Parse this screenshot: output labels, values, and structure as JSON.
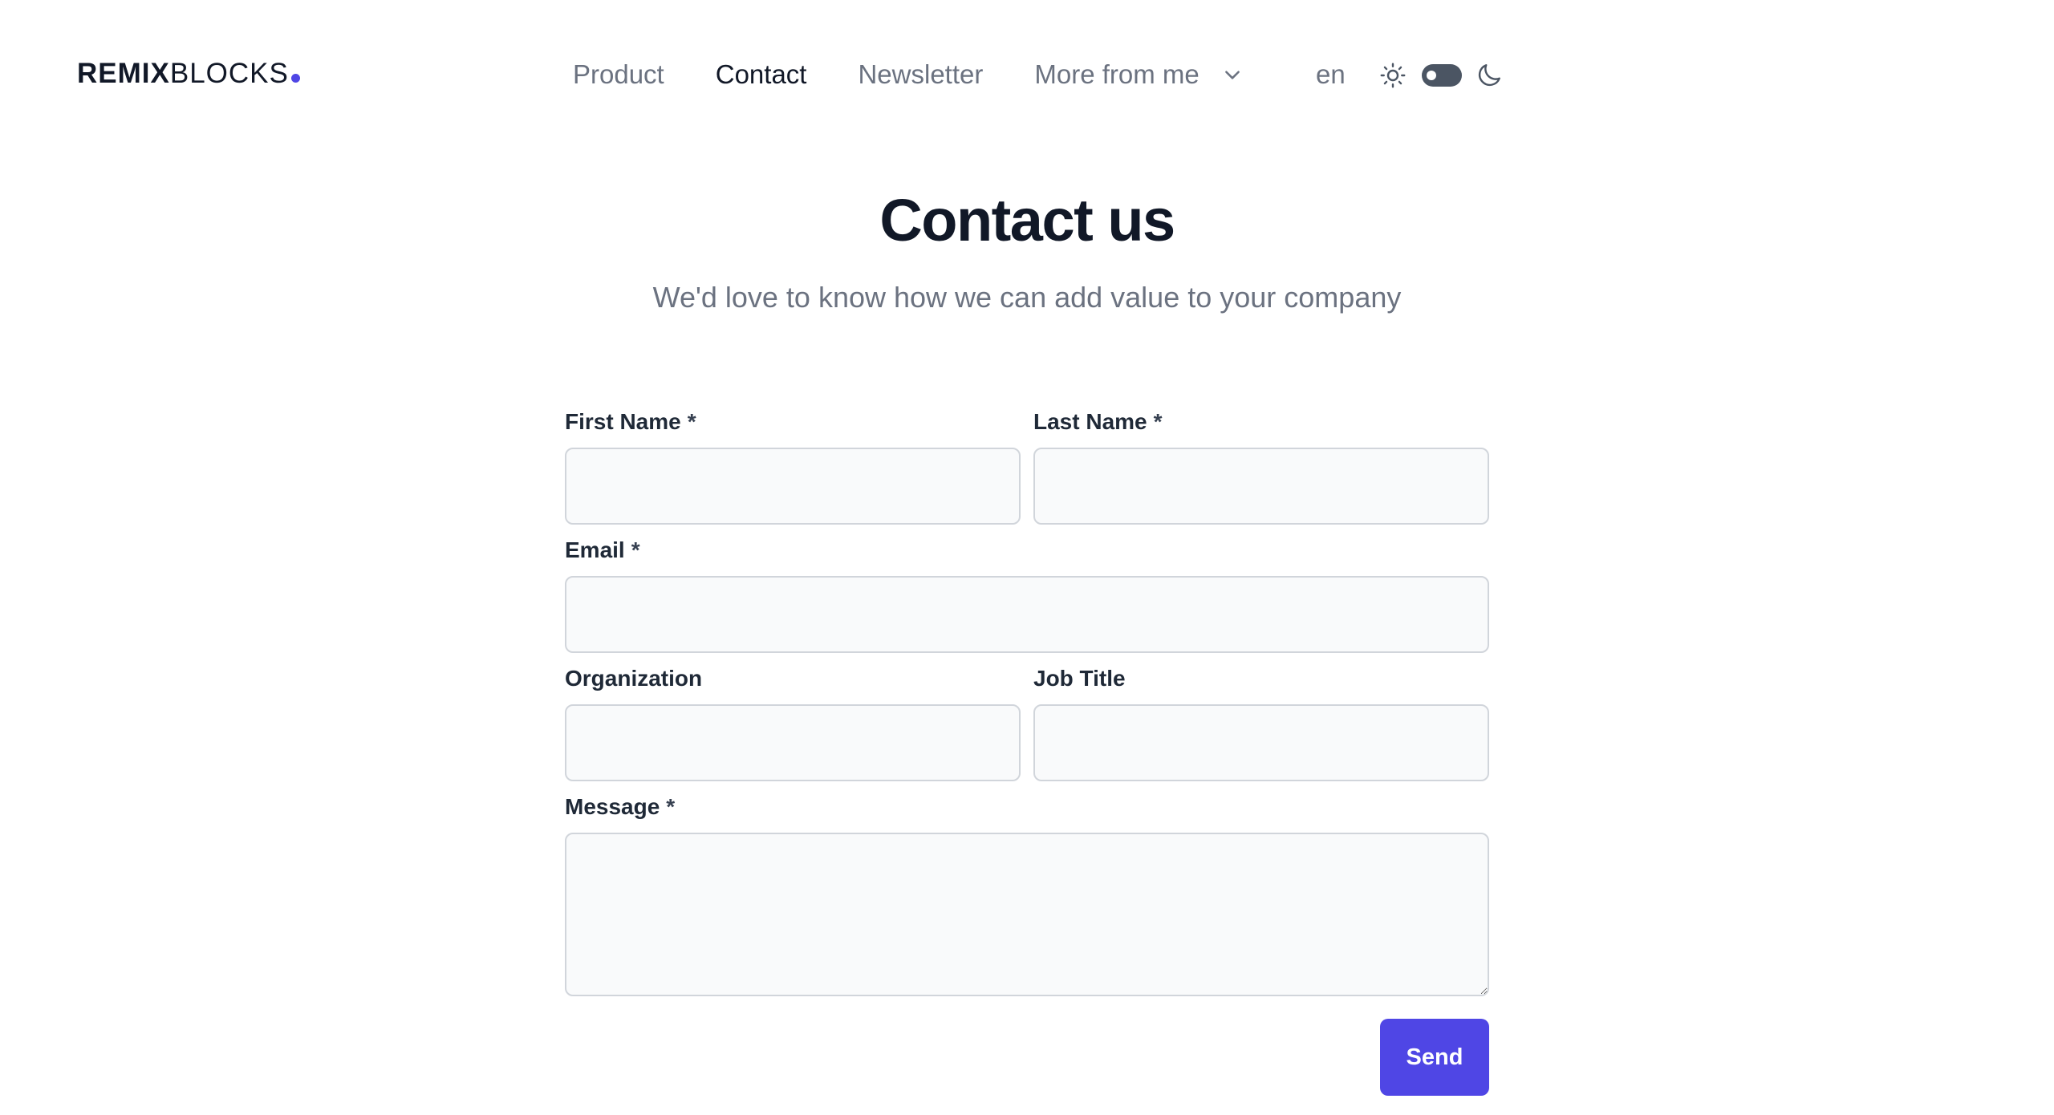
{
  "brand": {
    "logo_bold": "REMIX",
    "logo_light": "BLOCKS",
    "dot_color": "#4f46e5"
  },
  "nav": {
    "items": [
      {
        "label": "Product",
        "active": false
      },
      {
        "label": "Contact",
        "active": true
      },
      {
        "label": "Newsletter",
        "active": false
      }
    ],
    "more_label": "More from me",
    "more_icon": "chevron-down-icon",
    "language": "en",
    "theme_toggle": {
      "light_icon": "sun-icon",
      "dark_icon": "moon-icon",
      "mode": "light"
    }
  },
  "hero": {
    "title": "Contact us",
    "subtitle": "We'd love to know how we can add value to your company"
  },
  "form": {
    "first_name": {
      "label": "First Name",
      "required_mark": "*",
      "value": ""
    },
    "last_name": {
      "label": "Last Name",
      "required_mark": "*",
      "value": ""
    },
    "email": {
      "label": "Email",
      "required_mark": "*",
      "value": ""
    },
    "organization": {
      "label": "Organization",
      "value": ""
    },
    "job_title": {
      "label": "Job Title",
      "value": ""
    },
    "message": {
      "label": "Message",
      "required_mark": "*",
      "value": ""
    },
    "submit_label": "Send",
    "accent_color": "#4f46e5"
  }
}
